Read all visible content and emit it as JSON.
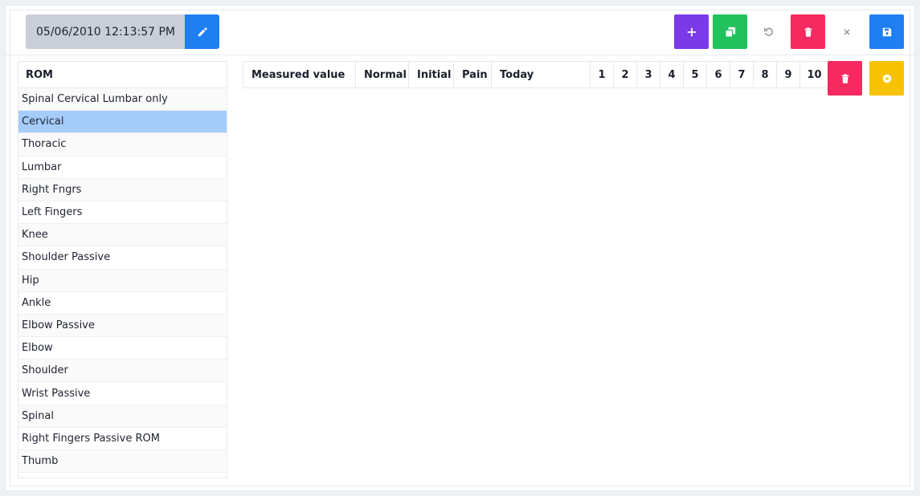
{
  "header": {
    "datetime": "05/06/2010 12:13:57 PM"
  },
  "toolbar": {
    "icons": {
      "edit": "pencil-icon",
      "add": "plus-icon",
      "copy": "copy-icon",
      "undo": "undo-icon",
      "delete": "trash-icon",
      "close": "close-icon",
      "save": "save-icon"
    },
    "colors": {
      "edit": "#1f7ff2",
      "add": "#7b3ae8",
      "copy": "#21c25c",
      "delete": "#f52a60",
      "save": "#1f7ff2",
      "clear": "#f7c200"
    }
  },
  "rom": {
    "header": "ROM",
    "items": [
      "Spinal Cervical Lumbar only",
      "Cervical",
      "Thoracic",
      "Lumbar",
      "Right Fngrs",
      "Left Fingers",
      "Knee",
      "Shoulder Passive",
      "Hip",
      "Ankle",
      "Elbow Passive",
      "Elbow",
      "Shoulder",
      "Wrist Passive",
      "Spinal",
      "Right Fingers Passive ROM",
      "Thumb"
    ],
    "selected": "Cervical"
  },
  "table": {
    "columns": [
      "Measured value",
      "Normal",
      "Initial",
      "Pain",
      "Today",
      "1",
      "2",
      "3",
      "4",
      "5",
      "6",
      "7",
      "8",
      "9",
      "10"
    ]
  }
}
